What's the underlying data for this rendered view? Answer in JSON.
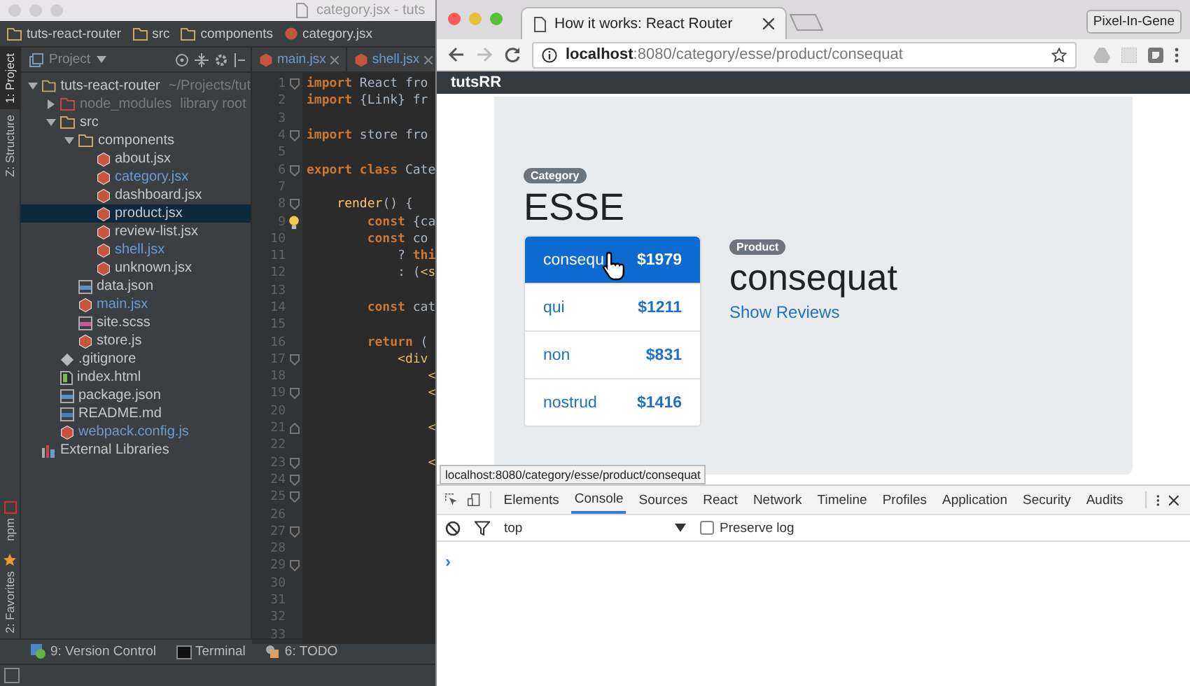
{
  "ide": {
    "title": "category.jsx - tuts",
    "breadcrumb": [
      "tuts-react-router",
      "src",
      "components",
      "category.jsx"
    ],
    "side_tabs_top": [
      {
        "label": "1: Project",
        "selected": true
      },
      {
        "label": "Z: Structure",
        "selected": false
      }
    ],
    "side_tabs_bottom": [
      {
        "label": "npm",
        "kind": "npm"
      },
      {
        "label": "2: Favorites",
        "kind": "favorites"
      }
    ],
    "project_header": "Project",
    "tree": [
      {
        "label": "tuts-react-router",
        "note": "~/Projects/tut",
        "kind": "folder",
        "color": "#c8c8c8",
        "selected": false,
        "expanded": true,
        "children": [
          {
            "label": "node_modules",
            "note": "library root",
            "kind": "libfolder",
            "color": "#7a7a7a",
            "selected": false,
            "expanded": false
          },
          {
            "label": "src",
            "kind": "folder",
            "color": "#c8c8c8",
            "selected": false,
            "expanded": true,
            "children": [
              {
                "label": "components",
                "kind": "folder",
                "color": "#c8c8c8",
                "selected": false,
                "expanded": true,
                "children": [
                  {
                    "label": "about.jsx",
                    "kind": "jsx",
                    "color": "#c8c8c8",
                    "selected": false
                  },
                  {
                    "label": "category.jsx",
                    "kind": "jsx",
                    "color": "#6b9bd2",
                    "selected": false
                  },
                  {
                    "label": "dashboard.jsx",
                    "kind": "jsx",
                    "color": "#c8c8c8",
                    "selected": false
                  },
                  {
                    "label": "product.jsx",
                    "kind": "jsx",
                    "color": "#c8c8c8",
                    "selected": true
                  },
                  {
                    "label": "review-list.jsx",
                    "kind": "jsx",
                    "color": "#c8c8c8",
                    "selected": false
                  },
                  {
                    "label": "shell.jsx",
                    "kind": "jsx",
                    "color": "#6b9bd2",
                    "selected": false
                  },
                  {
                    "label": "unknown.jsx",
                    "kind": "jsx",
                    "color": "#c8c8c8",
                    "selected": false
                  }
                ]
              },
              {
                "label": "data.json",
                "kind": "json",
                "color": "#c8c8c8",
                "selected": false
              },
              {
                "label": "main.jsx",
                "kind": "jsx",
                "color": "#6b9bd2",
                "selected": false
              },
              {
                "label": "site.scss",
                "kind": "scss",
                "color": "#c8c8c8",
                "selected": false
              },
              {
                "label": "store.js",
                "kind": "jsx",
                "color": "#c8c8c8",
                "selected": false
              }
            ]
          },
          {
            "label": ".gitignore",
            "kind": "git",
            "color": "#c8c8c8",
            "selected": false
          },
          {
            "label": "index.html",
            "kind": "html",
            "color": "#c8c8c8",
            "selected": false
          },
          {
            "label": "package.json",
            "kind": "json",
            "color": "#c8c8c8",
            "selected": false
          },
          {
            "label": "README.md",
            "kind": "md",
            "color": "#c8c8c8",
            "selected": false
          },
          {
            "label": "webpack.config.js",
            "kind": "jsx",
            "color": "#6b9bd2",
            "selected": false
          }
        ]
      },
      {
        "label": "External Libraries",
        "kind": "lib",
        "color": "#c8c8c8",
        "selected": false
      }
    ],
    "editor_tabs": [
      {
        "label": "main.jsx"
      },
      {
        "label": "shell.jsx"
      }
    ],
    "code_lines": [
      {
        "number": "1",
        "kind": "fold-start",
        "tokens": [
          {
            "kind": "keyword",
            "text": "import"
          },
          {
            "kind": "plain",
            "text": " React fro"
          }
        ]
      },
      {
        "number": "2",
        "tokens": [
          {
            "kind": "keyword",
            "text": "import"
          },
          {
            "kind": "plain",
            "text": " {Link} fr"
          }
        ]
      },
      {
        "number": "3"
      },
      {
        "number": "4",
        "kind": "fold-start",
        "tokens": [
          {
            "kind": "keyword",
            "text": "import"
          },
          {
            "kind": "plain",
            "text": " store fro"
          }
        ]
      },
      {
        "number": "5"
      },
      {
        "number": "6",
        "kind": "fold-start",
        "tokens": [
          {
            "kind": "keyword",
            "text": "export class"
          },
          {
            "kind": "plain",
            "text": " Cate"
          }
        ]
      },
      {
        "number": "7"
      },
      {
        "number": "8",
        "kind": "fold-start",
        "tokens": [
          {
            "kind": "method",
            "text": "    render"
          },
          {
            "kind": "plain",
            "text": "() {"
          }
        ]
      },
      {
        "number": "9",
        "kind": "bulb",
        "tokens": [
          {
            "kind": "keyword",
            "text": "        const"
          },
          {
            "kind": "plain",
            "text": " {ca"
          }
        ]
      },
      {
        "number": "10",
        "tokens": [
          {
            "kind": "keyword",
            "text": "        const"
          },
          {
            "kind": "plain",
            "text": " co"
          }
        ]
      },
      {
        "number": "11",
        "tokens": [
          {
            "kind": "plain",
            "text": "            ? "
          },
          {
            "kind": "keyword",
            "text": "thi"
          }
        ]
      },
      {
        "number": "12",
        "tokens": [
          {
            "kind": "plain",
            "text": "            : ("
          },
          {
            "kind": "tag",
            "text": "<s"
          }
        ]
      },
      {
        "number": "13"
      },
      {
        "number": "14",
        "tokens": [
          {
            "kind": "keyword",
            "text": "        const"
          },
          {
            "kind": "plain",
            "text": " cat"
          }
        ]
      },
      {
        "number": "15"
      },
      {
        "number": "16",
        "tokens": [
          {
            "kind": "keyword",
            "text": "        return"
          },
          {
            "kind": "plain",
            "text": " ("
          }
        ]
      },
      {
        "number": "17",
        "kind": "fold-start",
        "tokens": [
          {
            "kind": "tag",
            "text": "            <div"
          }
        ]
      },
      {
        "number": "18",
        "tokens": [
          {
            "kind": "tag",
            "text": "                <"
          }
        ]
      },
      {
        "number": "19",
        "kind": "fold-start",
        "tokens": [
          {
            "kind": "tag",
            "text": "                <"
          }
        ]
      },
      {
        "number": "20"
      },
      {
        "number": "21",
        "kind": "fold-end",
        "tokens": [
          {
            "kind": "tag",
            "text": "                <"
          }
        ]
      },
      {
        "number": "22"
      },
      {
        "number": "23",
        "kind": "fold-start",
        "tokens": [
          {
            "kind": "tag",
            "text": "                <"
          }
        ]
      },
      {
        "number": "24",
        "kind": "fold-start"
      },
      {
        "number": "25",
        "kind": "fold-start"
      },
      {
        "number": "26"
      },
      {
        "number": "27",
        "kind": "fold-start"
      },
      {
        "number": "28"
      },
      {
        "number": "29",
        "kind": "fold-start"
      },
      {
        "number": "30"
      },
      {
        "number": "31"
      },
      {
        "number": "32"
      },
      {
        "number": "33"
      }
    ],
    "bottom_tools": [
      {
        "label": "9: Version Control",
        "kind": "vcs"
      },
      {
        "label": "Terminal",
        "kind": "terminal"
      },
      {
        "label": "6: TODO",
        "kind": "todo"
      }
    ]
  },
  "browser": {
    "tab": {
      "title": "How it works: React Router"
    },
    "profile": "Pixel-In-Gene",
    "url": {
      "host": "localhost",
      "rest": ":8080/category/esse/product/consequat"
    },
    "page": {
      "brand": "tutsRR",
      "category": {
        "badge": "Category",
        "name": "ESSE"
      },
      "products": [
        {
          "name": "consequ",
          "price": "$1979",
          "selected": true
        },
        {
          "name": "qui",
          "price": "$1211",
          "selected": false
        },
        {
          "name": "non",
          "price": "$831",
          "selected": false
        },
        {
          "name": "nostrud",
          "price": "$1416",
          "selected": false
        }
      ],
      "product": {
        "badge": "Product",
        "name": "consequat",
        "link": "Show Reviews"
      }
    },
    "status_url": "localhost:8080/category/esse/product/consequat",
    "devtools": {
      "tabs": [
        {
          "label": "Elements",
          "selected": false
        },
        {
          "label": "Console",
          "selected": true
        },
        {
          "label": "Sources",
          "selected": false
        },
        {
          "label": "React",
          "selected": false
        },
        {
          "label": "Network",
          "selected": false
        },
        {
          "label": "Timeline",
          "selected": false
        },
        {
          "label": "Profiles",
          "selected": false
        },
        {
          "label": "Application",
          "selected": false
        },
        {
          "label": "Security",
          "selected": false
        },
        {
          "label": "Audits",
          "selected": false
        }
      ],
      "context": "top",
      "preserve_log": {
        "label": "Preserve log",
        "checked": false
      },
      "prompt": "›"
    }
  }
}
